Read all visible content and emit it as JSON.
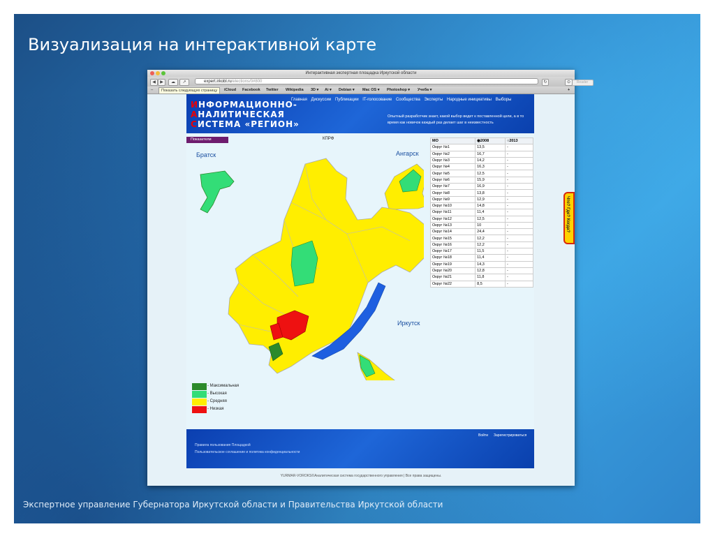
{
  "slide": {
    "title": "Визуализация на интерактивной карте",
    "footer": "Экспертное управление Губернатора Иркутской области и Правительства Иркутской области"
  },
  "browser": {
    "window_title": "Интерактивная экспертная площадка Иркутской области",
    "url_host": "expert.irkobl.ru",
    "url_path": "/elections/0#800",
    "reader_label": "Reader",
    "tooltip": "Показать следующую страницу",
    "bookmarks": [
      "iCloud",
      "Facebook",
      "Twitter",
      "Wikipedia",
      "3D ▾",
      "Ai ▾",
      "Debian ▾",
      "Mac OS ▾",
      "Photoshop ▾",
      "Учеба ▾"
    ]
  },
  "site": {
    "logo": [
      {
        "first": "И",
        "rest": "НФОРМАЦИОННО-"
      },
      {
        "first": "А",
        "rest": "НАЛИТИЧЕСКАЯ"
      },
      {
        "first": "С",
        "rest": "ИСТЕМА «РЕГИОН»"
      }
    ],
    "nav": [
      "Главная",
      "Дискуссии",
      "Публикации",
      "IT-голосование",
      "Сообщества",
      "Эксперты",
      "Народные инициативы",
      "Выборы"
    ],
    "tagline": "Опытный разработчик знает, какой выбор ведет к поставленной цели, а в то время как новичок каждый раз делает шаг в неизвестность",
    "filter_label": "Показатели",
    "party": "КПРФ",
    "cities": {
      "bratsk": "Братск",
      "angarsk": "Ангарск",
      "irkutsk": "Иркутск"
    },
    "legend": [
      {
        "label": "- Максимальная",
        "color": "#2b8a2b"
      },
      {
        "label": "- Высокая",
        "color": "#33dd77"
      },
      {
        "label": "- Средняя",
        "color": "#ffee00"
      },
      {
        "label": "- Низкая",
        "color": "#ee1111"
      }
    ],
    "side_tab": "Что? Где? Когда?",
    "footer_links": [
      "Войти",
      "Зарегистрироваться"
    ],
    "footer_lines": [
      "Правила пользования Площадкой",
      "Пользовательское соглашение и политика конфиденциальности"
    ],
    "copyright": "YURMAR-VOROKS©Аналитическая система государственного управления | Все права защищены."
  },
  "table": {
    "headers": [
      "МО",
      "2008",
      "2013"
    ],
    "rows": [
      [
        "Округ №1",
        "13,5",
        "-"
      ],
      [
        "Округ №2",
        "16,7",
        "-"
      ],
      [
        "Округ №3",
        "14,2",
        "-"
      ],
      [
        "Округ №4",
        "16,3",
        "-"
      ],
      [
        "Округ №5",
        "12,5",
        "-"
      ],
      [
        "Округ №6",
        "15,9",
        "-"
      ],
      [
        "Округ №7",
        "16,9",
        "-"
      ],
      [
        "Округ №8",
        "13,8",
        "-"
      ],
      [
        "Округ №9",
        "12,9",
        "-"
      ],
      [
        "Округ №10",
        "14,8",
        "-"
      ],
      [
        "Округ №11",
        "11,4",
        "-"
      ],
      [
        "Округ №12",
        "12,5",
        "-"
      ],
      [
        "Округ №13",
        "10",
        "-"
      ],
      [
        "Округ №14",
        "24,4",
        "-"
      ],
      [
        "Округ №15",
        "12,2",
        "-"
      ],
      [
        "Округ №16",
        "12,2",
        "-"
      ],
      [
        "Округ №17",
        "11,5",
        "-"
      ],
      [
        "Округ №18",
        "11,4",
        "-"
      ],
      [
        "Округ №19",
        "14,3",
        "-"
      ],
      [
        "Округ №20",
        "12,8",
        "-"
      ],
      [
        "Округ №21",
        "11,8",
        "-"
      ],
      [
        "Округ №22",
        "8,5",
        "-"
      ]
    ]
  }
}
